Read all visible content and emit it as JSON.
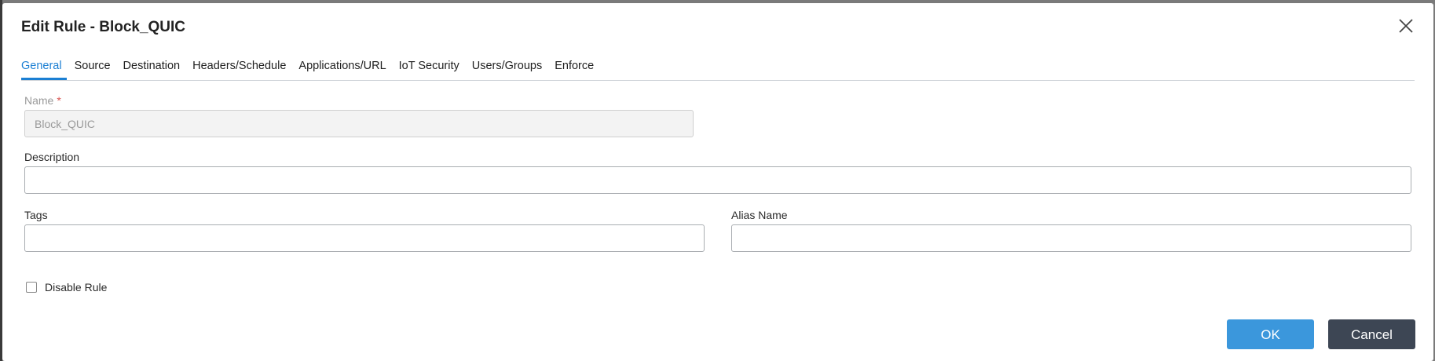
{
  "dialog": {
    "title": "Edit Rule - Block_QUIC",
    "close_icon": "close-icon"
  },
  "tabs": [
    {
      "label": "General",
      "active": true
    },
    {
      "label": "Source",
      "active": false
    },
    {
      "label": "Destination",
      "active": false
    },
    {
      "label": "Headers/Schedule",
      "active": false
    },
    {
      "label": "Applications/URL",
      "active": false
    },
    {
      "label": "IoT Security",
      "active": false
    },
    {
      "label": "Users/Groups",
      "active": false
    },
    {
      "label": "Enforce",
      "active": false
    }
  ],
  "form": {
    "name_label": "Name",
    "name_required_mark": "*",
    "name_value": "Block_QUIC",
    "description_label": "Description",
    "description_value": "",
    "tags_label": "Tags",
    "tags_value": "",
    "alias_label": "Alias Name",
    "alias_value": "",
    "disable_rule_label": "Disable Rule",
    "disable_rule_checked": false
  },
  "buttons": {
    "ok": "OK",
    "cancel": "Cancel"
  },
  "colors": {
    "accent": "#1b7fd3",
    "ok_button": "#3b97dc",
    "cancel_button": "#3d4654",
    "required": "#d9534f"
  }
}
